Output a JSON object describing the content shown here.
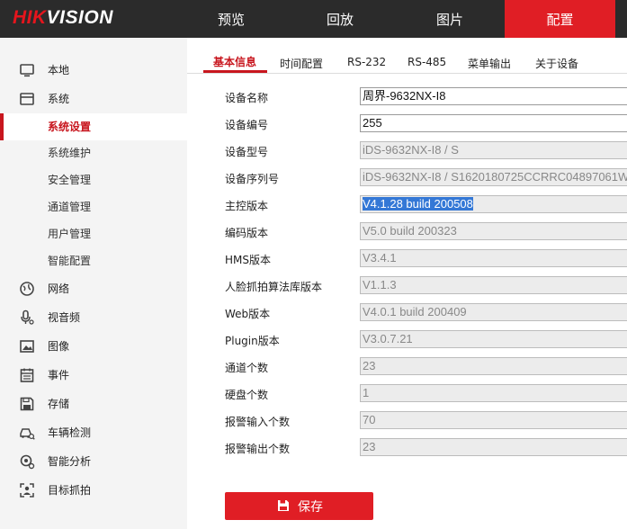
{
  "brand": {
    "part1": "HIK",
    "part2": "VISION"
  },
  "nav": {
    "preview": "预览",
    "playback": "回放",
    "picture": "图片",
    "config": "配置"
  },
  "sidebar": {
    "local": "本地",
    "system": "系统",
    "sub": {
      "settings": "系统设置",
      "maintenance": "系统维护",
      "security": "安全管理",
      "channel": "通道管理",
      "user": "用户管理",
      "smart": "智能配置"
    },
    "network": "网络",
    "av": "视音频",
    "image": "图像",
    "event": "事件",
    "storage": "存储",
    "vehicle": "车辆检测",
    "analysis": "智能分析",
    "capture": "目标抓拍"
  },
  "tabs": [
    "基本信息",
    "时间配置",
    "RS-232",
    "RS-485",
    "菜单输出",
    "关于设备"
  ],
  "fields": [
    {
      "label": "设备名称",
      "value": "周界-9632NX-I8"
    },
    {
      "label": "设备编号",
      "value": "255"
    },
    {
      "label": "设备型号",
      "value": "iDS-9632NX-I8 / S"
    },
    {
      "label": "设备序列号",
      "value": "iDS-9632NX-I8 / S1620180725CCRRC04897061W"
    },
    {
      "label": "主控版本",
      "value": "V4.1.28 build 200508"
    },
    {
      "label": "编码版本",
      "value": "V5.0 build 200323"
    },
    {
      "label": "HMS版本",
      "value": "V3.4.1"
    },
    {
      "label": "人脸抓拍算法库版本",
      "value": "V1.1.3"
    },
    {
      "label": "Web版本",
      "value": "V4.0.1 build 200409"
    },
    {
      "label": "Plugin版本",
      "value": "V3.0.7.21"
    },
    {
      "label": "通道个数",
      "value": "23"
    },
    {
      "label": "硬盘个数",
      "value": "1"
    },
    {
      "label": "报警输入个数",
      "value": "70"
    },
    {
      "label": "报警输出个数",
      "value": "23"
    }
  ],
  "save_label": "保存",
  "colors": {
    "accent": "#e01e25",
    "topbar": "#2b2b2b",
    "sidebar": "#f4f4f4",
    "highlight": "#3478d6"
  }
}
